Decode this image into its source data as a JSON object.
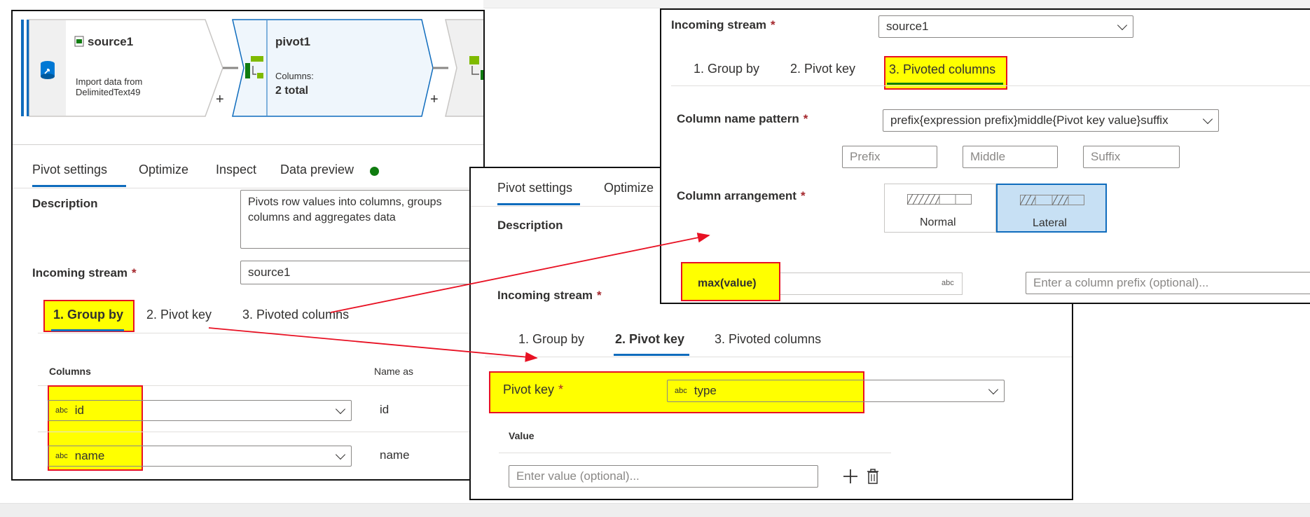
{
  "flow": {
    "source": {
      "name": "source1",
      "desc_line1": "Import data from",
      "desc_line2": "DelimitedText49"
    },
    "pivot": {
      "name": "pivot1",
      "columns_label": "Columns:",
      "columns_value": "2 total"
    },
    "plus": "+"
  },
  "left_panel": {
    "tabs": [
      "Pivot settings",
      "Optimize",
      "Inspect",
      "Data preview"
    ],
    "description_label": "Description",
    "description_value": "Pivots row values into columns, groups columns and aggregates data",
    "incoming_label": "Incoming stream",
    "incoming_value": "source1",
    "required": "*",
    "subtabs": [
      "1. Group by",
      "2. Pivot key",
      "3. Pivoted columns"
    ],
    "columns_header": "Columns",
    "name_as_header": "Name as",
    "rows": [
      {
        "type": "abc",
        "column": "id",
        "name_as": "id"
      },
      {
        "type": "abc",
        "column": "name",
        "name_as": "name"
      }
    ]
  },
  "middle_panel": {
    "tabs": [
      "Pivot settings",
      "Optimize"
    ],
    "description_label": "Description",
    "incoming_label": "Incoming stream",
    "subtabs": [
      "1. Group by",
      "2. Pivot key",
      "3. Pivoted columns"
    ],
    "pivot_key_label": "Pivot key",
    "pivot_key_type": "abc",
    "pivot_key_value": "type",
    "value_header": "Value",
    "value_placeholder": "Enter value (optional)..."
  },
  "right_panel": {
    "incoming_label": "Incoming stream",
    "incoming_value": "source1",
    "subtabs": [
      "1. Group by",
      "2. Pivot key",
      "3. Pivoted columns"
    ],
    "pattern_label": "Column name pattern",
    "pattern_value": "prefix{expression prefix}middle{Pivot key value}suffix",
    "prefix_placeholder": "Prefix",
    "middle_placeholder": "Middle",
    "suffix_placeholder": "Suffix",
    "arrangement_label": "Column arrangement",
    "arrangement_options": [
      "Normal",
      "Lateral"
    ],
    "expression_value": "max(value)",
    "expression_type": "abc",
    "prefix_input_placeholder": "Enter a column prefix (optional)..."
  },
  "colors": {
    "accent": "#0f6cbd",
    "highlight": "#ffff00",
    "highlight_border": "#e81123",
    "arrow": "#e81123",
    "status_dot": "#107c10"
  }
}
